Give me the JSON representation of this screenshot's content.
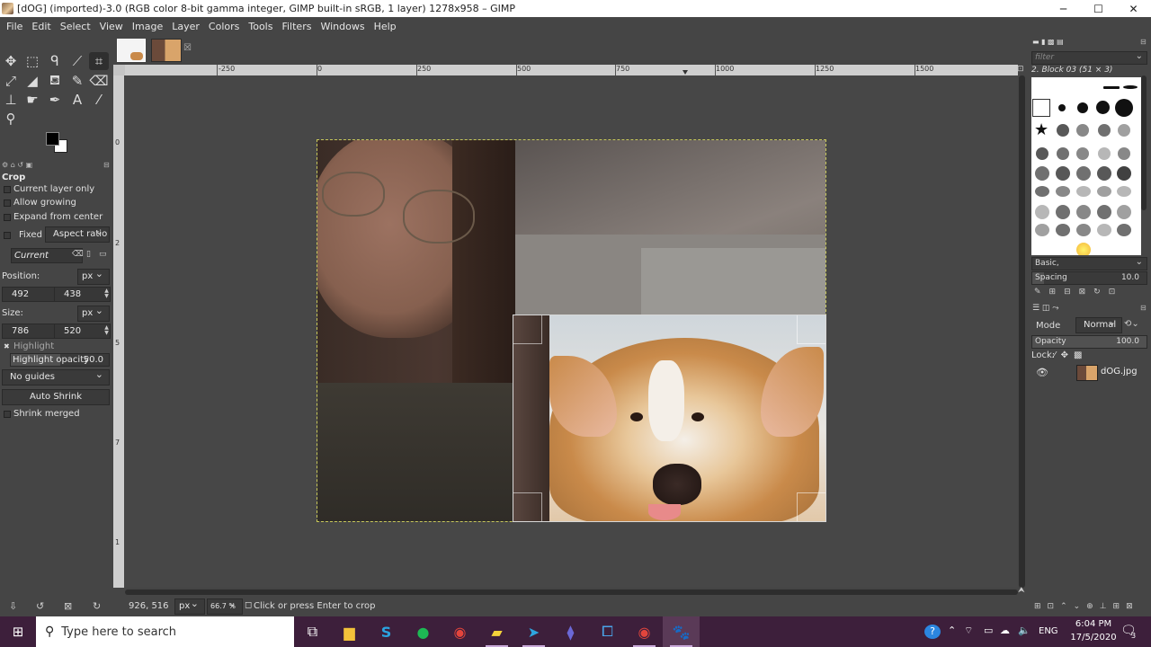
{
  "window": {
    "title": "[dOG] (imported)-3.0 (RGB color 8-bit gamma integer, GIMP built-in sRGB, 1 layer) 1278x958 – GIMP",
    "minimize": "─",
    "maximize": "☐",
    "close": "✕"
  },
  "menu": [
    "File",
    "Edit",
    "Select",
    "View",
    "Image",
    "Layer",
    "Colors",
    "Tools",
    "Filters",
    "Windows",
    "Help"
  ],
  "tabs": {
    "close_glyph": "☒"
  },
  "tool_options": {
    "title": "Crop",
    "current_layer_only": "Current layer only",
    "allow_growing": "Allow growing",
    "expand_from_center": "Expand from center",
    "fixed_label": "Fixed",
    "fixed_mode": "Aspect ratio",
    "current_value": "Current",
    "position_label": "Position:",
    "position_unit": "px",
    "position_x": "492",
    "position_y": "438",
    "size_label": "Size:",
    "size_unit": "px",
    "size_w": "786",
    "size_h": "520",
    "highlight": "Highlight",
    "highlight_opacity_label": "Highlight opacity",
    "highlight_opacity_value": "50.0",
    "guides": "No guides",
    "auto_shrink": "Auto Shrink",
    "shrink_merged": "Shrink merged"
  },
  "rulers": {
    "h": [
      "-250",
      "0",
      "250",
      "500",
      "750",
      "1000",
      "1250",
      "1500"
    ],
    "v": [
      "0",
      "2",
      "5",
      "7",
      "1"
    ]
  },
  "status": {
    "coords": "926, 516",
    "unit": "px",
    "zoom": "66.7 %",
    "message": "Click or press Enter to crop"
  },
  "brushes": {
    "filter_placeholder": "filter",
    "selected": "2. Block 03 (51 × 3)",
    "preset": "Basic,",
    "spacing_label": "Spacing",
    "spacing_value": "10.0"
  },
  "layers": {
    "mode_label": "Mode",
    "mode_value": "Normal",
    "opacity_label": "Opacity",
    "opacity_value": "100.0",
    "lock_label": "Lock:",
    "layer_name": "dOG.jpg"
  },
  "taskbar": {
    "search_placeholder": "Type here to search",
    "language": "ENG",
    "time": "6:04 PM",
    "date": "17/5/2020",
    "notifications": "3"
  },
  "colors": {
    "bg": "#454545",
    "ruler": "#cfcfcf",
    "taskbar": "#3d1f3b"
  }
}
